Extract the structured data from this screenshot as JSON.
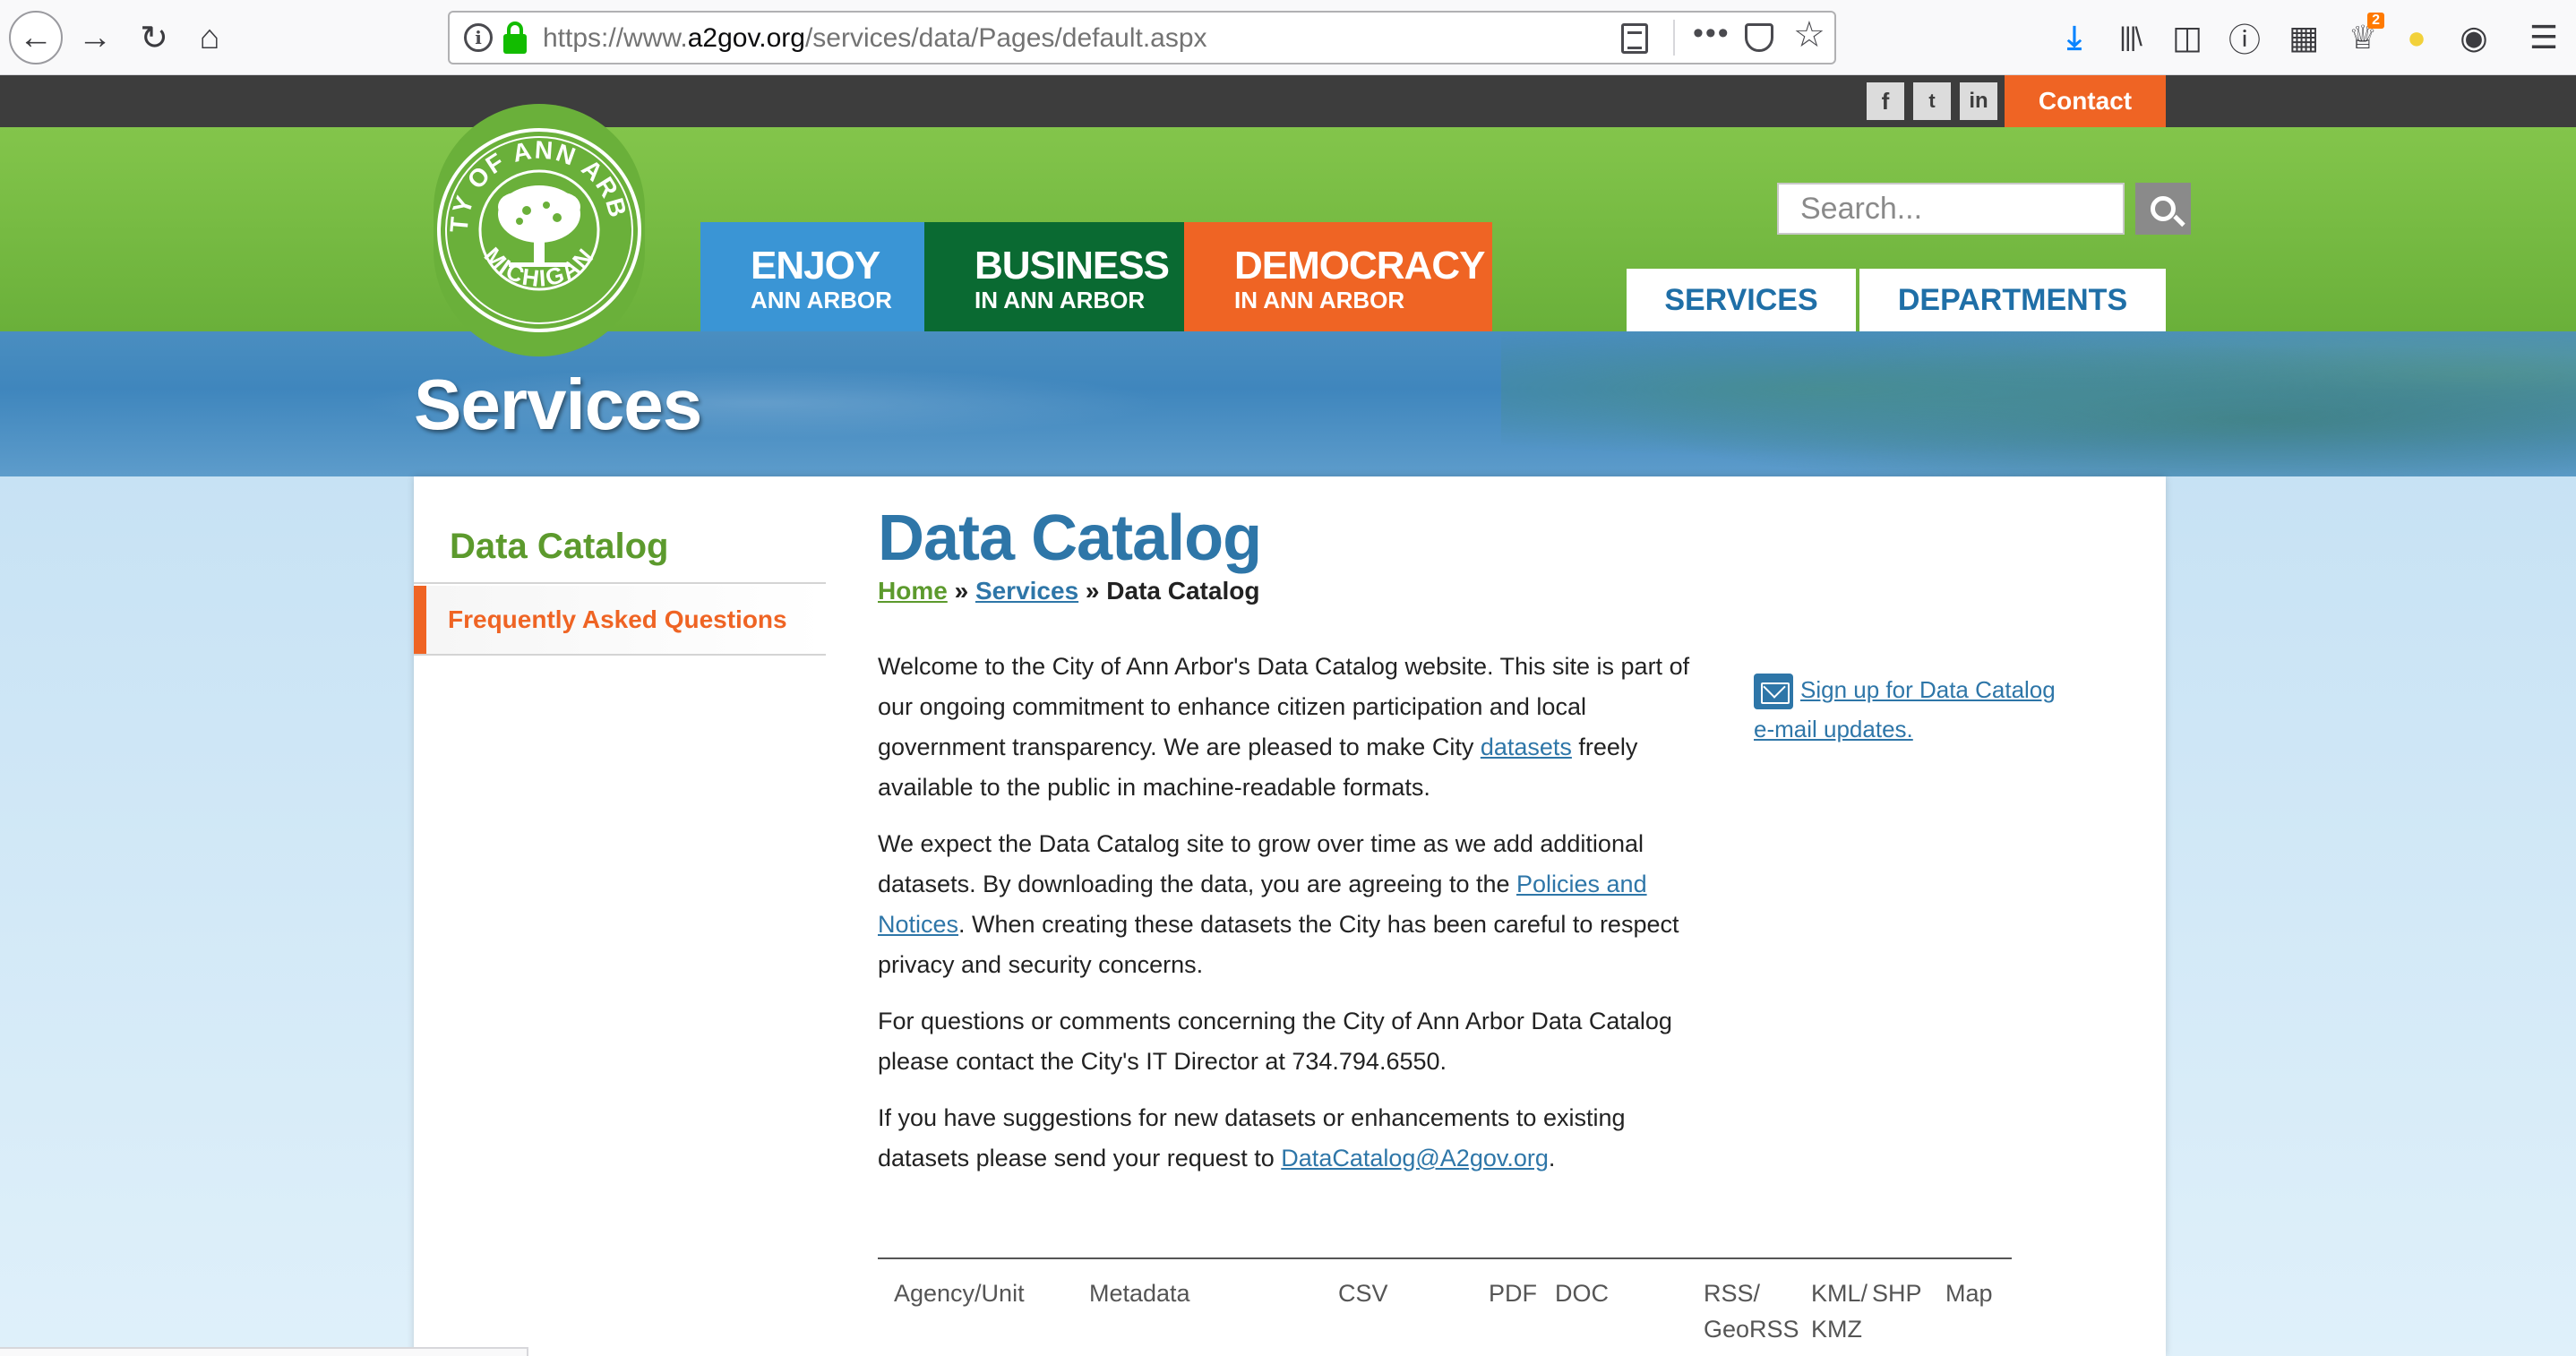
{
  "browser": {
    "url_prefix": "https://www.",
    "url_domain": "a2gov.org",
    "url_path": "/services/data/Pages/default.aspx",
    "icons": [
      "back-icon",
      "forward-icon",
      "reload-icon",
      "home-icon",
      "site-info-icon",
      "lock-icon",
      "reader-view-icon",
      "page-actions-icon",
      "pocket-icon",
      "bookmark-star-icon",
      "downloads-icon",
      "library-icon",
      "sidebar-icon",
      "extension-icon",
      "reader-list-icon",
      "addon-icon",
      "bulb-icon",
      "account-icon",
      "menu-icon"
    ],
    "addon_badge": "2"
  },
  "topbar": {
    "social": [
      "f",
      "t",
      "in"
    ],
    "contact_label": "Contact"
  },
  "seal": {
    "top_text": "CITY OF ANN ARBOR",
    "bottom_text": "MICHIGAN"
  },
  "mainnav": [
    {
      "big": "ENJOY",
      "small": "ANN ARBOR"
    },
    {
      "big": "BUSINESS",
      "small": "IN ANN ARBOR"
    },
    {
      "big": "DEMOCRACY",
      "small": "IN ANN ARBOR"
    }
  ],
  "search": {
    "placeholder": "Search..."
  },
  "tabs": {
    "services": "SERVICES",
    "departments": "DEPARTMENTS"
  },
  "hero": {
    "title": "Services"
  },
  "sidebar": {
    "title": "Data Catalog",
    "items": [
      {
        "label": "Frequently Asked Questions"
      }
    ]
  },
  "main": {
    "title": "Data Catalog",
    "breadcrumb": {
      "home": "Home",
      "sep": " » ",
      "services": "Services",
      "current": "Data Catalog"
    },
    "p1_a": "Welcome to the City of Ann Arbor's Data Catalog website.  This site is part of our ongoing commitment to enhance citizen participation and local government transparency.  We are pleased to make City ",
    "p1_link": "datasets",
    "p1_b": " freely available to the public in machine-readable formats.",
    "p2_a": "We expect the Data Catalog site to grow over time as we add additional datasets.  By downloading the data, you are agreeing to the ",
    "p2_link": "Policies and Notices",
    "p2_b": ".  When creating these datasets the City has been careful to respect privacy and security concerns.",
    "p3": "For questions or comments concerning the City of Ann Arbor Data Catalog please contact the City's IT Director at 734.794.6550.",
    "p4_a": "If you have suggestions for new datasets or enhancements to existing datasets please send your request to ",
    "p4_link": "DataCatalog@A2gov.org",
    "p4_b": ".",
    "signup_line1": "Sign up for Data Catalog ",
    "signup_line2": "e-mail updates."
  },
  "table": {
    "headers": [
      "Agency/Unit",
      "Metadata",
      "CSV",
      "PDF",
      "DOC",
      "RSS/\nGeoRSS",
      "KML/\nKMZ",
      "SHP",
      "Map"
    ]
  }
}
